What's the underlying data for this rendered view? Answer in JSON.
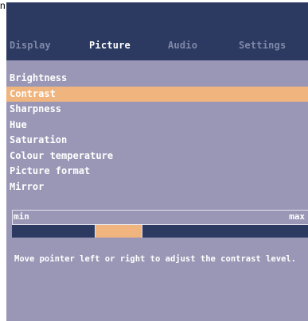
{
  "corner_text": "n",
  "tabs": [
    {
      "label": "Display",
      "active": false
    },
    {
      "label": "Picture",
      "active": true
    },
    {
      "label": "Audio",
      "active": false
    },
    {
      "label": "Settings",
      "active": false
    }
  ],
  "menu": {
    "items": [
      {
        "label": "Brightness",
        "selected": false
      },
      {
        "label": "Contrast",
        "selected": true
      },
      {
        "label": "Sharpness",
        "selected": false
      },
      {
        "label": "Hue",
        "selected": false
      },
      {
        "label": "Saturation",
        "selected": false
      },
      {
        "label": "Colour temperature",
        "selected": false
      },
      {
        "label": "Picture format",
        "selected": false
      },
      {
        "label": "Mirror",
        "selected": false
      }
    ]
  },
  "slider": {
    "min_label": "min",
    "max_label": "max",
    "thumb_start_fraction": 0.28,
    "thumb_end_fraction": 0.44
  },
  "hint": "Move pointer left or right to adjust the contrast level.",
  "colors": {
    "panel_bg": "#9a97b6",
    "header_bg": "#2c3a62",
    "highlight": "#f0b47e",
    "text": "#ffffff",
    "inactive_tab": "#8088a8"
  }
}
